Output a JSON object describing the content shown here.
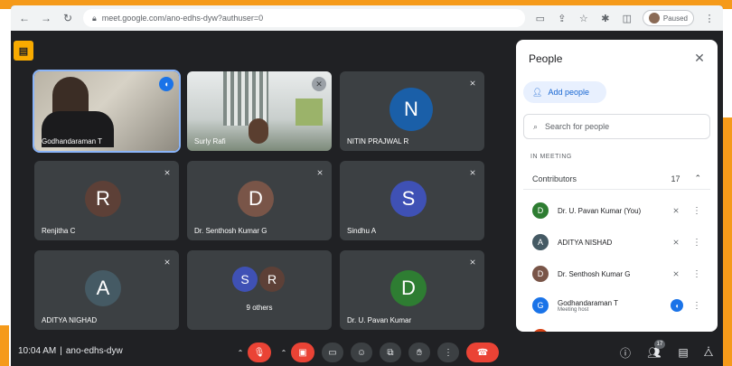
{
  "browser": {
    "url": "meet.google.com/ano-edhs-dyw?authuser=0",
    "profile_label": "Paused"
  },
  "tiles": [
    {
      "name": "Godhandaraman T"
    },
    {
      "name": "Surly Rafi"
    },
    {
      "name": "NITIN PRAJWAL R",
      "initial": "N",
      "color": "#1a5fa8"
    },
    {
      "name": "Renjitha C",
      "initial": "R",
      "color": "#5d4037"
    },
    {
      "name": "Dr. Senthosh Kumar G",
      "initial": "D",
      "color": "#795548"
    },
    {
      "name": "Sindhu A",
      "initial": "S",
      "color": "#3f51b5"
    },
    {
      "name": "ADITYA NIGHAD",
      "initial": "A",
      "color": "#455a64"
    },
    {
      "name": "9 others",
      "initial_a": "S",
      "color_a": "#3f51b5",
      "initial_b": "R",
      "color_b": "#5d4037"
    },
    {
      "name": "Dr. U. Pavan Kumar",
      "initial": "D",
      "color": "#2e7d32"
    }
  ],
  "bottom": {
    "time": "10:04 AM",
    "separator": "|",
    "meeting_code": "ano-edhs-dyw",
    "people_count": "17"
  },
  "panel": {
    "title": "People",
    "add_label": "Add people",
    "search_placeholder": "Search for people",
    "section_label": "IN MEETING",
    "group_label": "Contributors",
    "group_count": "17",
    "people": [
      {
        "name": "Dr. U. Pavan Kumar (You)",
        "initial": "D",
        "color": "#2e7d32"
      },
      {
        "name": "ADITYA NISHAD",
        "initial": "A",
        "color": "#455a64"
      },
      {
        "name": "Dr. Senthosh Kumar G",
        "initial": "D",
        "color": "#795548"
      },
      {
        "name": "Godhandaraman T",
        "sub": "Meeting host",
        "initial": "G",
        "color": "#1a73e8"
      },
      {
        "name": "",
        "initial": "",
        "color": "#d84315"
      }
    ]
  }
}
